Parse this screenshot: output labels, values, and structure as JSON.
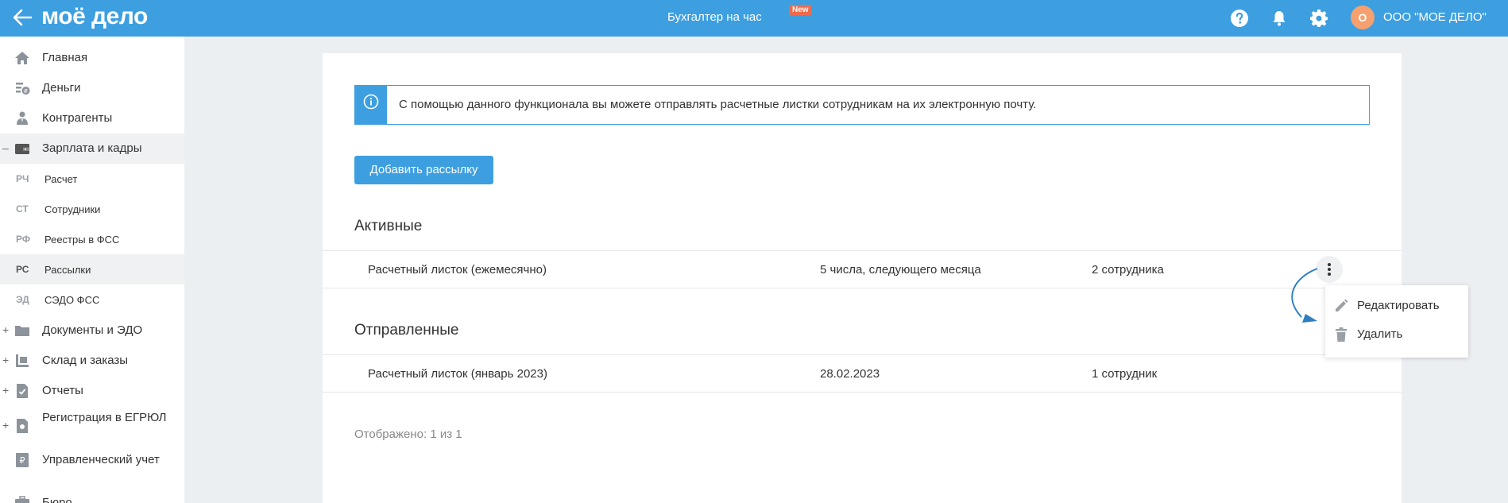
{
  "topbar": {
    "logo_text": "моё дело",
    "center_link": "Бухгалтер на час",
    "new_badge": "New",
    "avatar_letter": "О",
    "org_name": "ООО \"МОЕ ДЕЛО\"",
    "icons": [
      "back-arrow-icon",
      "help-icon",
      "bell-icon",
      "gear-icon"
    ]
  },
  "sidebar": {
    "items": [
      {
        "label": "Главная",
        "icon": "home-icon",
        "expander": ""
      },
      {
        "label": "Деньги",
        "icon": "money-icon",
        "expander": ""
      },
      {
        "label": "Контрагенты",
        "icon": "contractors-icon",
        "expander": ""
      },
      {
        "label": "Зарплата и кадры",
        "icon": "wallet-icon",
        "expander": "–"
      },
      {
        "label": "Документы и ЭДО",
        "icon": "folder-icon",
        "expander": "+"
      },
      {
        "label": "Склад и заказы",
        "icon": "warehouse-icon",
        "expander": "+"
      },
      {
        "label": "Отчеты",
        "icon": "report-icon",
        "expander": "+"
      },
      {
        "label": "Регистрация в ЕГРЮЛ",
        "icon": "registration-icon",
        "expander": "+"
      },
      {
        "label": "Управленческий учет",
        "icon": "accounting-icon",
        "expander": ""
      },
      {
        "label": "Бюро",
        "icon": "briefcase-icon",
        "expander": ""
      }
    ],
    "sub_items": [
      {
        "abbr": "РЧ",
        "label": "Расчет"
      },
      {
        "abbr": "СТ",
        "label": "Сотрудники"
      },
      {
        "abbr": "РФ",
        "label": "Реестры в ФСС"
      },
      {
        "abbr": "РС",
        "label": "Рассылки"
      },
      {
        "abbr": "ЭД",
        "label": "СЭДО ФСС"
      }
    ]
  },
  "main": {
    "info_text": "С помощью данного функционала вы можете отправлять расчетные листки сотрудникам на их электронную почту.",
    "add_button": "Добавить рассылку",
    "active_title": "Активные",
    "active_rows": [
      {
        "name": "Расчетный листок (ежемесячно)",
        "schedule": "5 числа, следующего месяца",
        "employees": "2 сотрудника"
      }
    ],
    "sent_title": "Отправленные",
    "sent_rows": [
      {
        "name": "Расчетный листок (январь 2023)",
        "schedule": "28.02.2023",
        "employees": "1 сотрудник"
      }
    ],
    "footer_count": "Отображено: 1 из 1"
  },
  "menu": {
    "edit_label": "Редактировать",
    "delete_label": "Удалить"
  },
  "colors": {
    "accent": "#3d9fe0",
    "badge": "#ef6a4d",
    "avatar": "#f5a06e",
    "active_bg": "#eff1f3"
  }
}
